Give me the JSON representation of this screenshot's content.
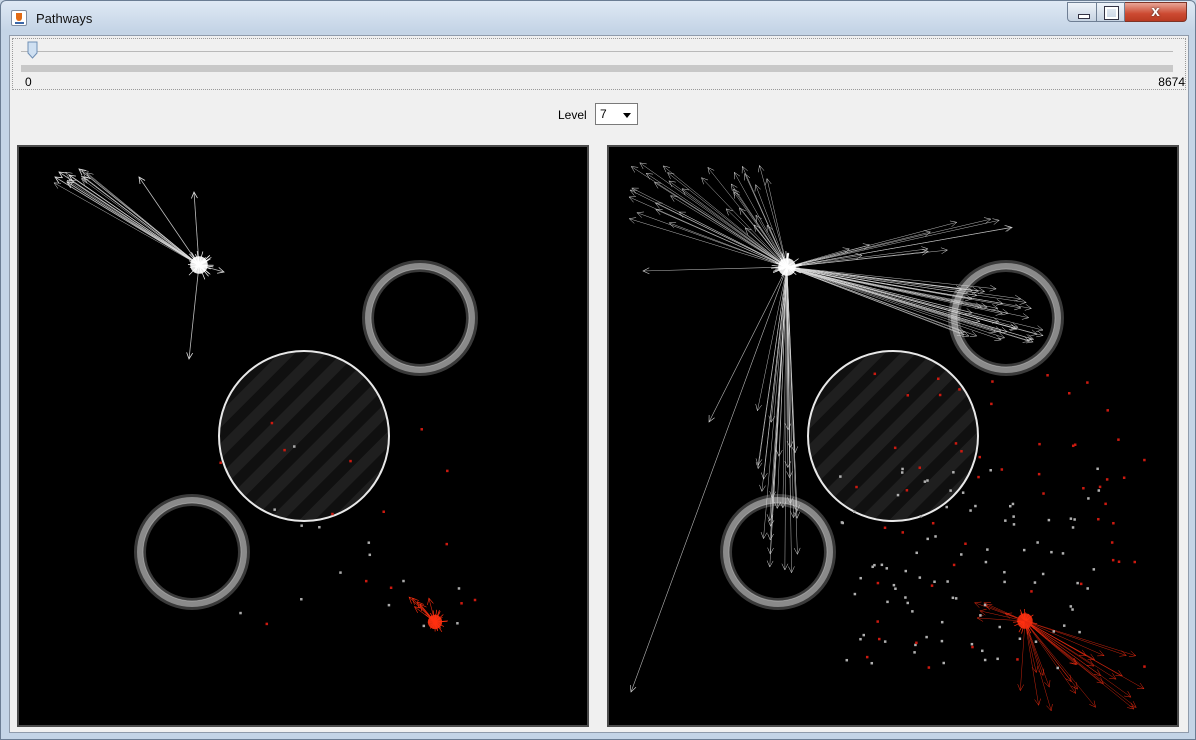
{
  "window": {
    "title": "Pathways",
    "icon": "java-cup-icon"
  },
  "controls": {
    "close_glyph": "x"
  },
  "slider": {
    "min_label": "0",
    "max_label": "8674",
    "value": 0,
    "min": 0,
    "max": 8674
  },
  "level": {
    "label": "Level",
    "value": "7"
  },
  "colors": {
    "background": "#000000",
    "white_agent": "#ffffff",
    "red_agent": "#ff3010",
    "ring": "#8a8a8a"
  }
}
